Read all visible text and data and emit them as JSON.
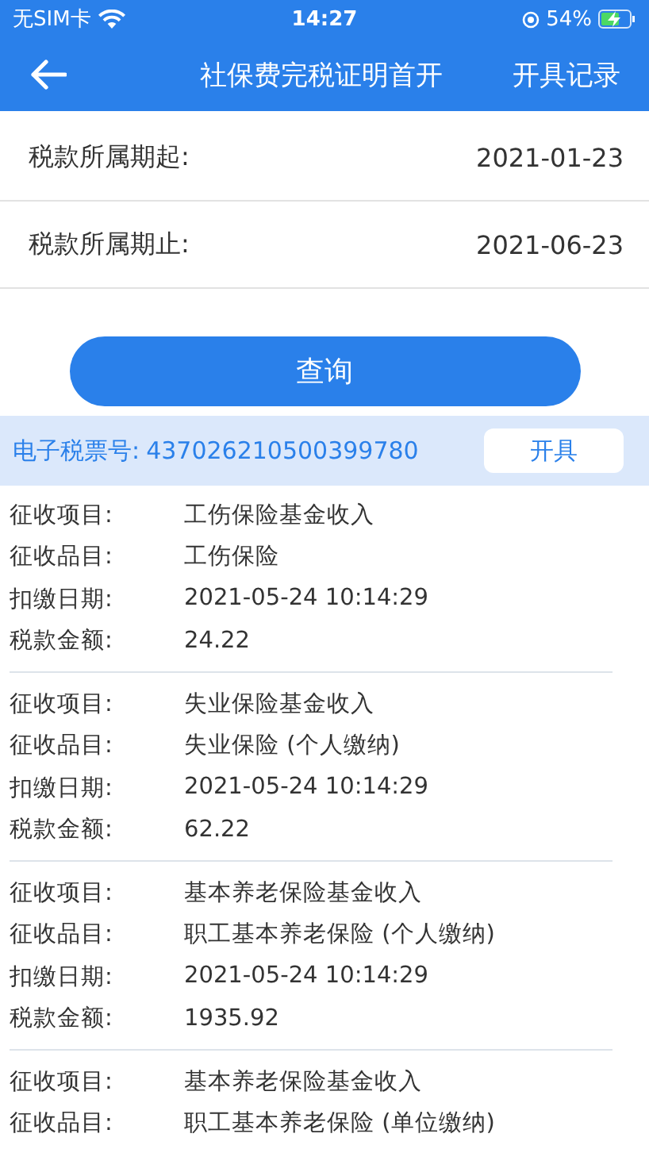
{
  "status_bar": {
    "carrier": "无SIM卡",
    "time": "14:27",
    "battery": "54%",
    "charging": true
  },
  "nav": {
    "title": "社保费完税证明首开",
    "action": "开具记录"
  },
  "form": [
    {
      "label": "税款所属期起:",
      "value": "2021-01-23"
    },
    {
      "label": "税款所属期止:",
      "value": "2021-06-23"
    }
  ],
  "query_button": "查询",
  "ticket": {
    "label": "电子税票号:",
    "number": "437026210500399780",
    "button": "开具"
  },
  "records": [
    {
      "fields": [
        {
          "label": "征收项目:",
          "value": "工伤保险基金收入"
        },
        {
          "label": "征收品目:",
          "value": "工伤保险"
        },
        {
          "label": "扣缴日期:",
          "value": "2021-05-24 10:14:29"
        },
        {
          "label": "税款金额:",
          "value": "24.22"
        }
      ]
    },
    {
      "fields": [
        {
          "label": "征收项目:",
          "value": "失业保险基金收入"
        },
        {
          "label": "征收品目:",
          "value": "失业保险 (个人缴纳)"
        },
        {
          "label": "扣缴日期:",
          "value": "2021-05-24 10:14:29"
        },
        {
          "label": "税款金额:",
          "value": "62.22"
        }
      ]
    },
    {
      "fields": [
        {
          "label": "征收项目:",
          "value": "基本养老保险基金收入"
        },
        {
          "label": "征收品目:",
          "value": "职工基本养老保险 (个人缴纳)"
        },
        {
          "label": "扣缴日期:",
          "value": "2021-05-24 10:14:29"
        },
        {
          "label": "税款金额:",
          "value": "1935.92"
        }
      ]
    },
    {
      "fields": [
        {
          "label": "征收项目:",
          "value": "基本养老保险基金收入"
        },
        {
          "label": "征收品目:",
          "value": "职工基本养老保险 (单位缴纳)"
        }
      ]
    }
  ]
}
